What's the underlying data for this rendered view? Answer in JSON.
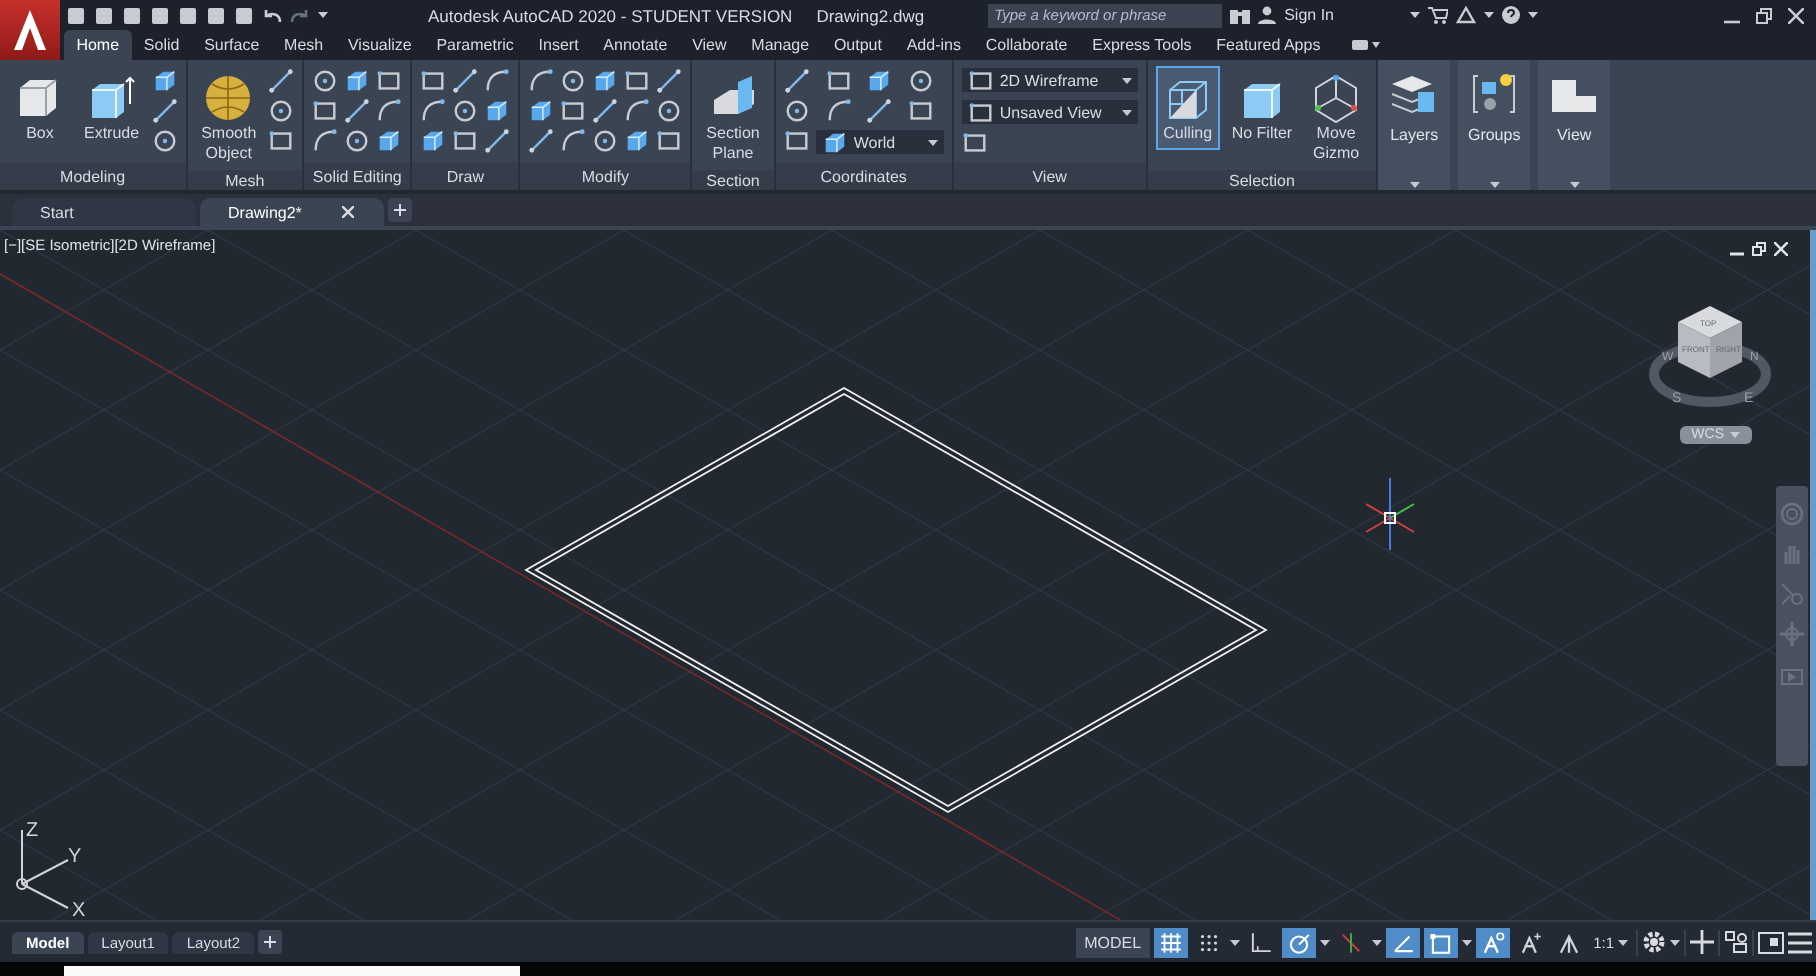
{
  "title_bar": {
    "title": "Autodesk AutoCAD 2020 - STUDENT VERSION",
    "file": "Drawing2.dwg",
    "search": {
      "placeholder": "Type a keyword or phrase"
    },
    "sign_in": "Sign In"
  },
  "ribbon_tabs": [
    {
      "label": "Home",
      "selected": true
    },
    {
      "label": "Solid",
      "selected": false
    },
    {
      "label": "Surface",
      "selected": false
    },
    {
      "label": "Mesh",
      "selected": false
    },
    {
      "label": "Visualize",
      "selected": false
    },
    {
      "label": "Parametric",
      "selected": false
    },
    {
      "label": "Insert",
      "selected": false
    },
    {
      "label": "Annotate",
      "selected": false
    },
    {
      "label": "View",
      "selected": false
    },
    {
      "label": "Manage",
      "selected": false
    },
    {
      "label": "Output",
      "selected": false
    },
    {
      "label": "Add-ins",
      "selected": false
    },
    {
      "label": "Collaborate",
      "selected": false
    },
    {
      "label": "Express Tools",
      "selected": false
    },
    {
      "label": "Featured Apps",
      "selected": false
    }
  ],
  "ribbon_panels": [
    {
      "kind": "tools",
      "label": "Modeling",
      "big": [
        {
          "kind": "box",
          "label": "Box"
        },
        {
          "kind": "extrude",
          "label": "Extrude"
        }
      ]
    },
    {
      "kind": "tools",
      "label": "Mesh",
      "big": [
        {
          "kind": "sphere",
          "label": "Smooth\nObject"
        }
      ]
    },
    {
      "kind": "tools",
      "label": "Solid Editing"
    },
    {
      "kind": "tools",
      "label": "Draw"
    },
    {
      "kind": "tools",
      "label": "Modify"
    },
    {
      "kind": "tools",
      "label": "Section",
      "big": [
        {
          "kind": "plane",
          "label": "Section\nPlane"
        }
      ]
    },
    {
      "kind": "tools",
      "label": "Coordinates",
      "dropdown": "World"
    },
    {
      "kind": "view",
      "label": "View",
      "dropdowns": [
        "2D Wireframe",
        "Unsaved View"
      ]
    },
    {
      "kind": "tools",
      "label": "Selection",
      "big": [
        {
          "kind": "culling",
          "label": "Culling",
          "on": true
        },
        {
          "kind": "filter",
          "label": "No Filter",
          "on": false
        },
        {
          "kind": "gizmo",
          "label": "Move\nGizmo",
          "on": false
        }
      ]
    },
    {
      "kind": "collapsed",
      "label": "Layers"
    },
    {
      "kind": "collapsed",
      "label": "Groups"
    },
    {
      "kind": "collapsed",
      "label": "View"
    }
  ],
  "doc_tabs": [
    {
      "label": "Start",
      "selected": false
    },
    {
      "label": "Drawing2*",
      "selected": true
    }
  ],
  "viewport": {
    "label": "[−][SE Isometric][2D Wireframe]",
    "viewcube": {
      "top": "TOP",
      "front": "FRONT",
      "right": "RIGHT",
      "n": "N",
      "e": "E",
      "s": "S",
      "w": "W",
      "ucs": "WCS"
    },
    "ucs_axes": {
      "x": "X",
      "y": "Y",
      "z": "Z"
    }
  },
  "layout_tabs": [
    {
      "label": "Model",
      "selected": true
    },
    {
      "label": "Layout1",
      "selected": false
    },
    {
      "label": "Layout2",
      "selected": false
    }
  ],
  "status_bar": {
    "model": "MODEL",
    "scale": "1:1",
    "toggles": [
      {
        "kind": "grid",
        "on": true
      },
      {
        "kind": "snap",
        "on": false
      },
      {
        "kind": "ortho",
        "on": false
      },
      {
        "kind": "polar",
        "on": true
      },
      {
        "kind": "isodraft",
        "on": false
      },
      {
        "kind": "angle",
        "on": true
      },
      {
        "kind": "osnap",
        "on": true
      },
      {
        "kind": "annotation",
        "on": true
      },
      {
        "kind": "autoscale",
        "on": false
      },
      {
        "kind": "visibility",
        "on": false
      }
    ]
  }
}
